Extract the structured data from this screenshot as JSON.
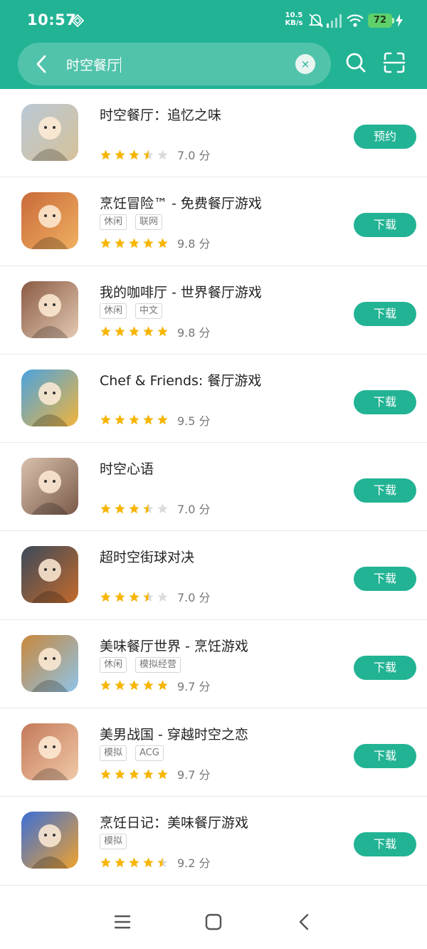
{
  "status_bar": {
    "time": "10:57",
    "net_speed_value": "10.5",
    "net_speed_unit": "KB/s",
    "battery": "72"
  },
  "search": {
    "query": "时空餐厅",
    "clear_glyph": "×"
  },
  "apps": [
    {
      "title": "时空餐厅：追忆之味",
      "tags": [],
      "stars": 3.5,
      "score": "7.0 分",
      "button": "预约",
      "icon": "anime-butler-icon",
      "colors": [
        "#b9c8d6",
        "#d6c29a"
      ]
    },
    {
      "title": "烹饪冒险™ - 免费餐厅游戏",
      "tags": [
        "休闲",
        "联网"
      ],
      "stars": 5,
      "score": "9.8 分",
      "button": "下载",
      "icon": "steak-plate-icon",
      "colors": [
        "#c96a3a",
        "#f0b060"
      ]
    },
    {
      "title": "我的咖啡厅 - 世界餐厅游戏",
      "tags": [
        "休闲",
        "中文"
      ],
      "stars": 5,
      "score": "9.8 分",
      "button": "下载",
      "icon": "coffee-cup-icon",
      "colors": [
        "#8a5a44",
        "#e4c9b2"
      ]
    },
    {
      "title": "Chef & Friends: 餐厅游戏",
      "tags": [],
      "stars": 5,
      "score": "9.5 分",
      "button": "下载",
      "icon": "chef-friends-burger-icon",
      "colors": [
        "#4aa3e0",
        "#f2b43c"
      ]
    },
    {
      "title": "时空心语",
      "tags": [],
      "stars": 3.5,
      "score": "7.0 分",
      "button": "下载",
      "icon": "anime-man-icon",
      "colors": [
        "#d9c1ad",
        "#7a5a4a"
      ]
    },
    {
      "title": "超时空街球对决",
      "tags": [],
      "stars": 3.5,
      "score": "7.0 分",
      "button": "下载",
      "icon": "basketball-player-icon",
      "colors": [
        "#3b4a5a",
        "#c46a2c"
      ]
    },
    {
      "title": "美味餐厅世界 - 烹饪游戏",
      "tags": [
        "休闲",
        "模拟经营"
      ],
      "stars": 5,
      "score": "9.7 分",
      "button": "下载",
      "icon": "chef-girl-icon",
      "colors": [
        "#c8873c",
        "#8fc4e8"
      ]
    },
    {
      "title": "美男战国 - 穿越时空之恋",
      "tags": [
        "模拟",
        "ACG"
      ],
      "stars": 5,
      "score": "9.7 分",
      "button": "下载",
      "icon": "romance-couple-icon",
      "colors": [
        "#c47a5a",
        "#f0c9a8"
      ]
    },
    {
      "title": "烹饪日记：美味餐厅游戏",
      "tags": [
        "模拟"
      ],
      "stars": 4.5,
      "score": "9.2 分",
      "button": "下载",
      "icon": "chef-burger-icon",
      "colors": [
        "#3b6fd6",
        "#f0a22e"
      ]
    }
  ],
  "colors": {
    "accent": "#22b394",
    "star": "#f7b500",
    "star_empty": "#dcdcdc"
  }
}
